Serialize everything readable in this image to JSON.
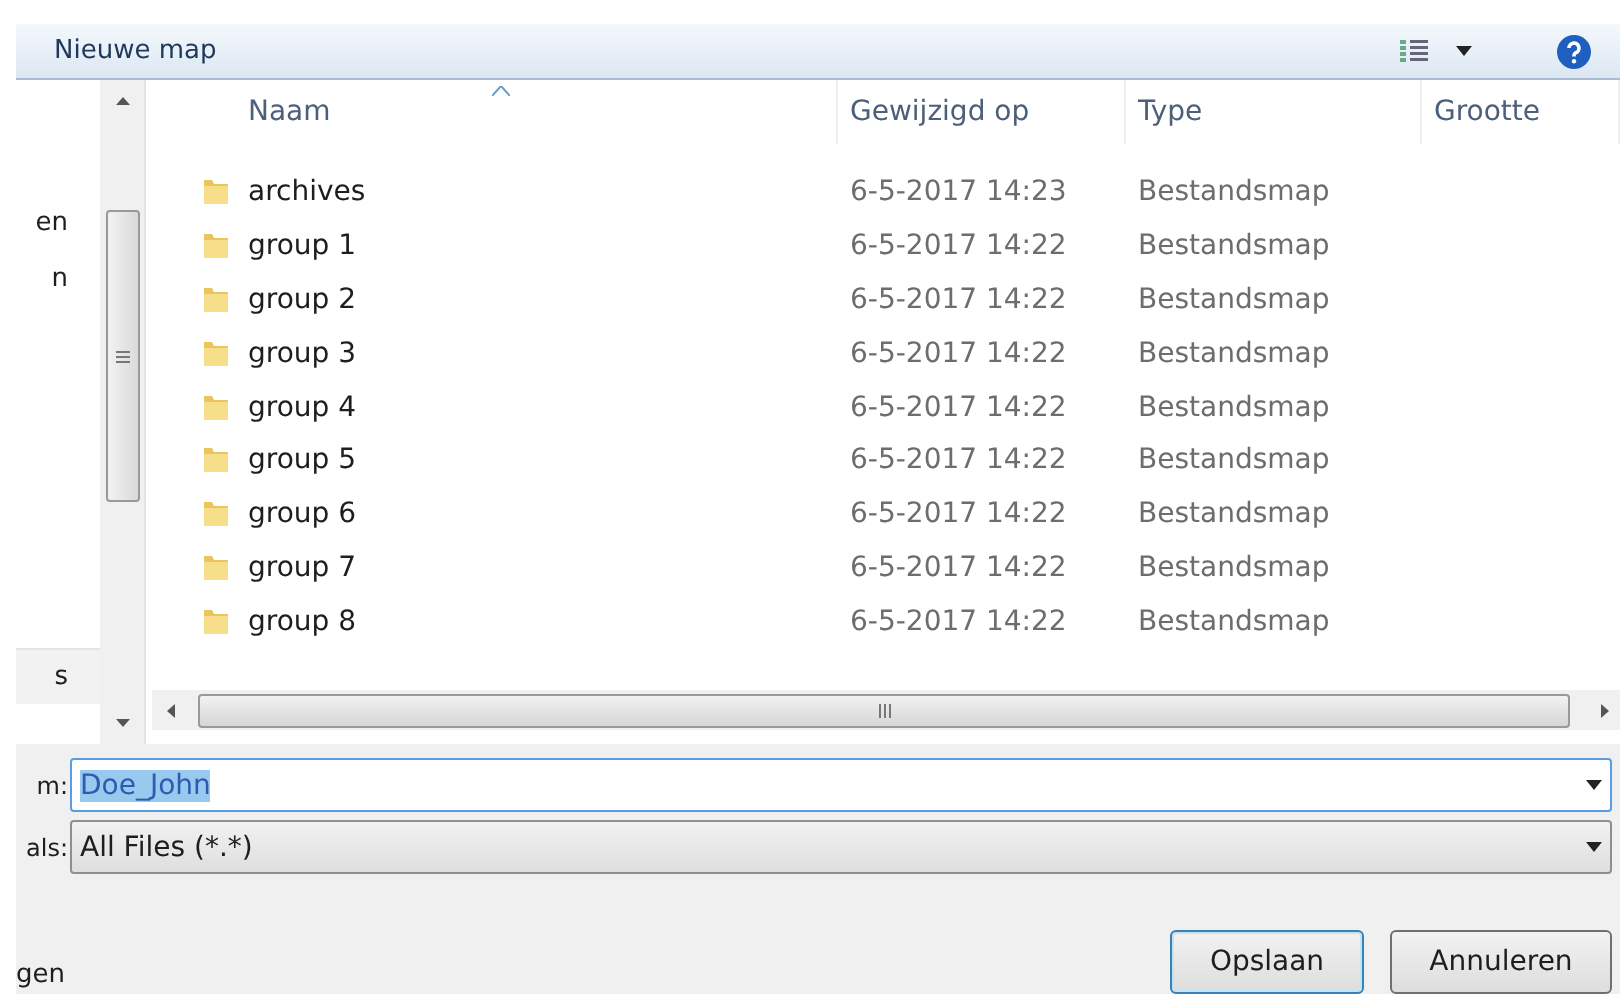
{
  "toolbar": {
    "new_folder": "Nieuwe map"
  },
  "nav_items": [
    {
      "label": "en",
      "selected": false
    },
    {
      "label": "n",
      "selected": false
    },
    {
      "label": "s",
      "selected": true
    }
  ],
  "table": {
    "columns": [
      {
        "label": "Naam",
        "sorted": true
      },
      {
        "label": "Gewijzigd op",
        "sorted": false
      },
      {
        "label": "Type",
        "sorted": false
      },
      {
        "label": "Grootte",
        "sorted": false
      }
    ],
    "rows": [
      {
        "name": "archives",
        "modified": "6-5-2017 14:23",
        "type": "Bestandsmap"
      },
      {
        "name": "group 1",
        "modified": "6-5-2017 14:22",
        "type": "Bestandsmap"
      },
      {
        "name": "group 2",
        "modified": "6-5-2017 14:22",
        "type": "Bestandsmap"
      },
      {
        "name": "group 3",
        "modified": "6-5-2017 14:22",
        "type": "Bestandsmap"
      },
      {
        "name": "group 4",
        "modified": "6-5-2017 14:22",
        "type": "Bestandsmap"
      },
      {
        "name": "group 5",
        "modified": "6-5-2017 14:22",
        "type": "Bestandsmap"
      },
      {
        "name": "group 6",
        "modified": "6-5-2017 14:22",
        "type": "Bestandsmap"
      },
      {
        "name": "group 7",
        "modified": "6-5-2017 14:22",
        "type": "Bestandsmap"
      },
      {
        "name": "group 8",
        "modified": "6-5-2017 14:22",
        "type": "Bestandsmap"
      }
    ]
  },
  "filename": {
    "label": "m:",
    "value": "Doe_John",
    "text_selected": true
  },
  "filetype": {
    "label": "als:",
    "value": "All Files (*.*)"
  },
  "hide_folders": "gen",
  "buttons": [
    {
      "label": "Opslaan",
      "default": true
    },
    {
      "label": "Annuleren",
      "default": false
    }
  ]
}
